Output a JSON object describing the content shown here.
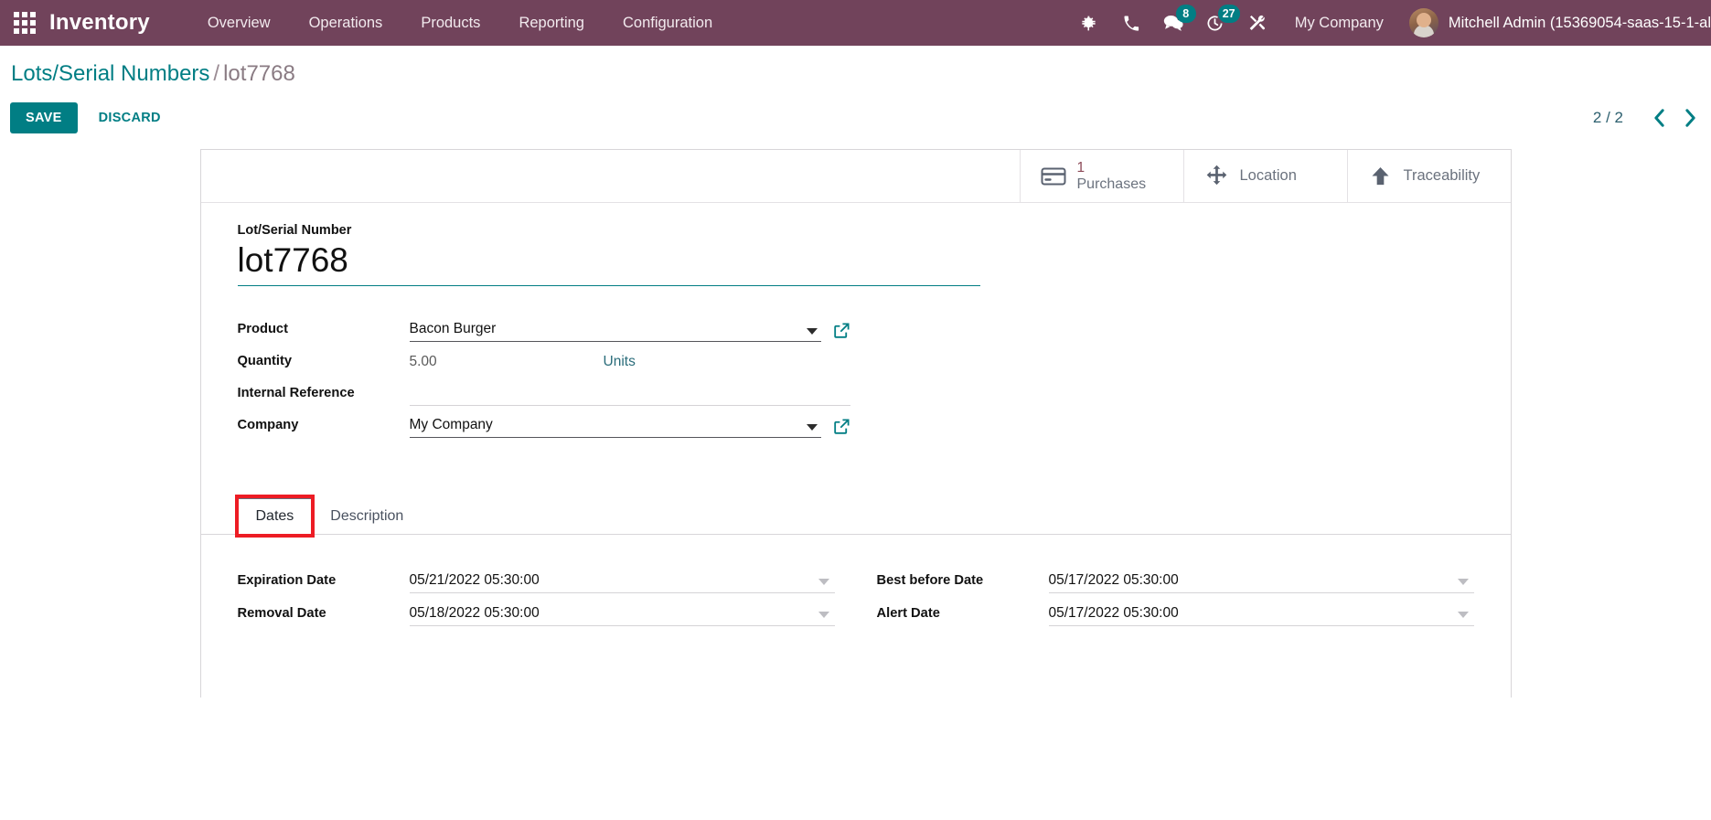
{
  "navbar": {
    "apps_icon": "apps-grid-icon",
    "brand": "Inventory",
    "menu_items": [
      {
        "label": "Overview"
      },
      {
        "label": "Operations"
      },
      {
        "label": "Products"
      },
      {
        "label": "Reporting"
      },
      {
        "label": "Configuration"
      }
    ],
    "icons": [
      {
        "name": "bug-icon",
        "badge": null
      },
      {
        "name": "phone-icon",
        "badge": null
      },
      {
        "name": "chat-icon",
        "badge": "8"
      },
      {
        "name": "activity-clock-icon",
        "badge": "27"
      },
      {
        "name": "tools-icon",
        "badge": null
      }
    ],
    "company": "My Company",
    "user": "Mitchell Admin (15369054-saas-15-1-al",
    "brand_color": "#71435b",
    "badge_color": "#017e84"
  },
  "control_panel": {
    "breadcrumb_root": "Lots/Serial Numbers",
    "breadcrumb_separator": "/",
    "breadcrumb_current": "lot7768",
    "save_label": "SAVE",
    "discard_label": "DISCARD",
    "pager_value": "2 / 2",
    "pager_prev_icon": "chevron-left-icon",
    "pager_next_icon": "chevron-right-icon",
    "accent_color": "#017e84"
  },
  "smart_buttons": [
    {
      "icon": "credit-card-icon",
      "value": "1",
      "label": "Purchases"
    },
    {
      "icon": "move-arrows-icon",
      "value": null,
      "label": "Location"
    },
    {
      "icon": "arrow-up-icon",
      "value": null,
      "label": "Traceability"
    }
  ],
  "form": {
    "title_label": "Lot/Serial Number",
    "title_value": "lot7768",
    "fields": [
      {
        "label": "Product",
        "value": "Bacon Burger",
        "dropdown": true,
        "external_link": true
      },
      {
        "label": "Quantity",
        "value": "5.00",
        "uom": "Units",
        "dropdown": false,
        "external_link": false
      },
      {
        "label": "Internal Reference",
        "value": "",
        "dropdown": false,
        "external_link": false
      },
      {
        "label": "Company",
        "value": "My Company",
        "dropdown": true,
        "external_link": true
      }
    ]
  },
  "notebook": {
    "tabs": [
      {
        "label": "Dates",
        "active": true,
        "highlighted": true
      },
      {
        "label": "Description",
        "active": false,
        "highlighted": false
      }
    ],
    "highlight_color": "#ed1c24",
    "dates_left": [
      {
        "label": "Expiration Date",
        "value": "05/21/2022 05:30:00"
      },
      {
        "label": "Removal Date",
        "value": "05/18/2022 05:30:00"
      }
    ],
    "dates_right": [
      {
        "label": "Best before Date",
        "value": "05/17/2022 05:30:00"
      },
      {
        "label": "Alert Date",
        "value": "05/17/2022 05:30:00"
      }
    ]
  }
}
